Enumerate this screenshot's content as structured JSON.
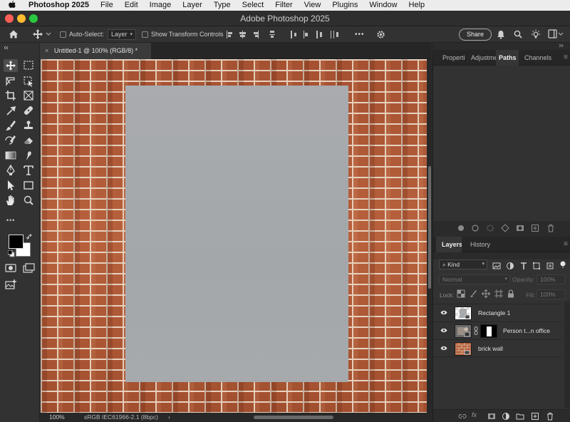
{
  "menubar": {
    "app_name": "Photoshop 2025",
    "items": [
      "File",
      "Edit",
      "Image",
      "Layer",
      "Type",
      "Select",
      "Filter",
      "View",
      "Plugins",
      "Window",
      "Help"
    ]
  },
  "titlebar": {
    "title": "Adobe Photoshop 2025"
  },
  "options": {
    "auto_select_label": "Auto-Select:",
    "auto_select_value": "Layer",
    "show_transform_label": "Show Transform Controls",
    "share_label": "Share",
    "more_label": "•••"
  },
  "document": {
    "tab_title": "Untitled-1 @ 100% (RGB/8) *",
    "close_glyph": "×"
  },
  "status": {
    "zoom": "100%",
    "color_profile": "sRGB IEC61966-2.1 (8bpc)",
    "arrow": "›"
  },
  "toolbar": {
    "more_label": "•••"
  },
  "panels": {
    "top_tabs": [
      "Properties",
      "Adjustments",
      "Paths",
      "Channels"
    ],
    "top_active": "Paths",
    "bottom_tabs": [
      "Layers",
      "History"
    ],
    "bottom_active": "Layers"
  },
  "layers": {
    "filter_label": "Kind",
    "blend_mode": "Normal",
    "opacity_label": "Opacity:",
    "opacity_value": "100%",
    "lock_label": "Lock:",
    "fill_label": "Fill:",
    "fill_value": "100%",
    "items": [
      {
        "name": "Rectangle 1"
      },
      {
        "name": "Person t...n office"
      },
      {
        "name": "brick wall"
      }
    ]
  },
  "colors": {
    "foreground": "#000000",
    "background": "#ffffff",
    "accent_light": "#ececec",
    "panel_bg": "#323232",
    "placeholder": "#a7aaad",
    "brick": "#b8613d"
  }
}
